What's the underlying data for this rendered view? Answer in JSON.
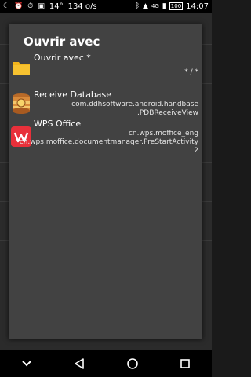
{
  "statusbar": {
    "temperature": "14°",
    "speed": "134 o/s",
    "network": "4G",
    "battery": "100",
    "time": "14:07"
  },
  "dialog": {
    "title": "Ouvrir avec",
    "items": [
      {
        "name": "Ouvrir avec *",
        "detail_lines": [
          "* / *"
        ],
        "icon": "folder-icon"
      },
      {
        "name": "Receive Database",
        "detail_lines": [
          "com.ddhsoftware.android.handbase",
          ".PDBReceiveView"
        ],
        "icon": "database-app-icon"
      },
      {
        "name": "WPS Office",
        "detail_lines": [
          "cn.wps.moffice_eng",
          "cn.wps.moffice.documentmanager.PreStartActivity",
          "2"
        ],
        "icon": "wps-office-icon"
      }
    ]
  },
  "colors": {
    "dialog_bg": "#424242",
    "statusbar_bg": "#000000",
    "folder_yellow": "#f2b51c",
    "wps_red": "#e8303a"
  }
}
